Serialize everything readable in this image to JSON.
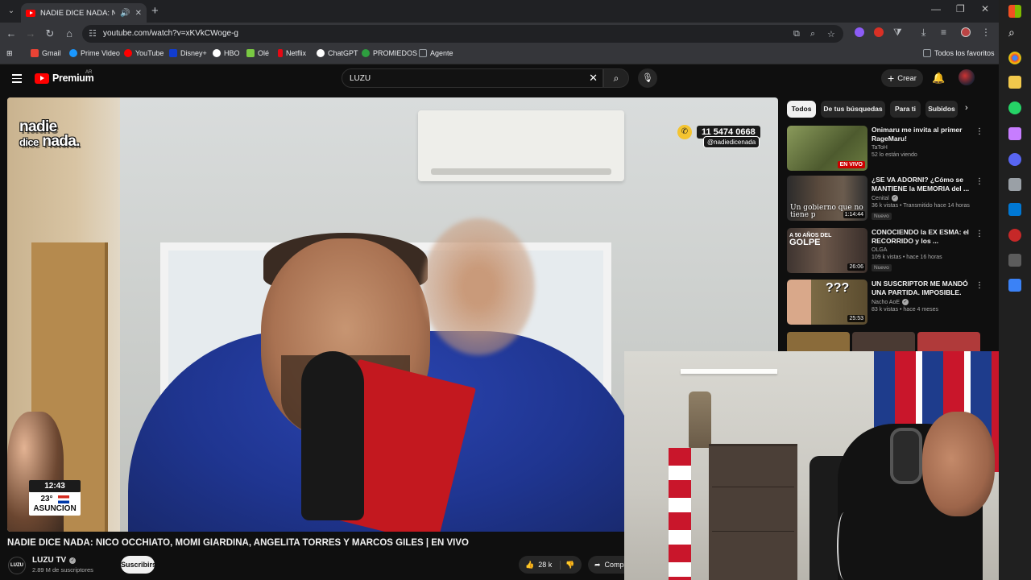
{
  "browser": {
    "tab_title": "NADIE DICE NADA: NICO O",
    "new_tab": "+",
    "url": "youtube.com/watch?v=xKVkCWoge-g",
    "bookmarks": [
      {
        "label": "Gmail",
        "color": "#ea4335"
      },
      {
        "label": "Prime Video",
        "color": "#1a98ff"
      },
      {
        "label": "YouTube",
        "color": "#ff0000"
      },
      {
        "label": "Disney+",
        "color": "#113ccf"
      },
      {
        "label": "HBO",
        "color": "#ffffff"
      },
      {
        "label": "Olé",
        "color": "#7ac943"
      },
      {
        "label": "Netflix",
        "color": "#e50914"
      },
      {
        "label": "ChatGPT",
        "color": "#ffffff"
      },
      {
        "label": "PROMIEDOS",
        "color": "#2e9e3f"
      },
      {
        "label": "Agente",
        "color": "#9aa0a6"
      }
    ],
    "all_bookmarks": "Todos los favoritos"
  },
  "youtube": {
    "logo_text": "Premium",
    "region": "AR",
    "search_query": "LUZU",
    "create_label": "Crear"
  },
  "video": {
    "overlay_logo_line1": "nadie",
    "overlay_logo_line2a": "dice",
    "overlay_logo_line2b": "nada.",
    "phone": "11 5474 0668",
    "handle": "@nadiedicenada",
    "clock_time": "12:43",
    "clock_temp": "23°",
    "clock_city": "ASUNCION",
    "title": "NADIE DICE NADA: NICO OCCHIATO, MOMI GIARDINA, ANGELITA TORRES Y MARCOS GILES | EN VIVO",
    "channel_name": "LUZU TV",
    "channel_avatar_text": "LUZU",
    "subscribers": "2.89 M de suscriptores",
    "subscribe_label": "Suscribirse",
    "likes": "28 k",
    "share_label": "Comp"
  },
  "sidebar": {
    "chips": [
      "Todos",
      "De tus búsquedas",
      "Para ti",
      "Subidos"
    ],
    "recommendations": [
      {
        "title": "Onimaru me invita al primer RageMaru!",
        "channel": "TaToH",
        "meta": "52 lo están viendo",
        "live": "EN VIVO",
        "verified": false,
        "badge": "",
        "thumb_color": "#5d6b3a"
      },
      {
        "title": "¿SE VA ADORNI? ¿Cómo se MANTIENE la MEMORIA del ...",
        "channel": "Cenital",
        "meta": "36 k vistas • Transmitido hace 14 horas",
        "duration": "1:14:44",
        "verified": true,
        "badge": "Nuevo",
        "thumb_text": "Un gobierno que no tiene p",
        "thumb_color": "#3c3c3c"
      },
      {
        "title": "CONOCIENDO la EX ESMA: el RECORRIDO y los ...",
        "channel": "OLGA",
        "meta": "109 k vistas • hace 16 horas",
        "duration": "26:06",
        "verified": false,
        "badge": "Nuevo",
        "thumb_text_small": "A 50 AÑOS DEL",
        "thumb_text_big": "GOLPE",
        "thumb_color": "#4a3d36"
      },
      {
        "title": "UN SUSCRIPTOR ME MANDÓ UNA PARTIDA. IMPOSIBLE.",
        "channel": "Nacho AoE",
        "meta": "83 k vistas • hace 4 meses",
        "duration": "25:53",
        "verified": true,
        "badge": "",
        "thumb_text": "???",
        "thumb_color": "#6b5a3b"
      }
    ]
  },
  "colors": {
    "accent_red": "#ff0000",
    "bg": "#0f0f0f",
    "chip_bg": "#272727"
  }
}
